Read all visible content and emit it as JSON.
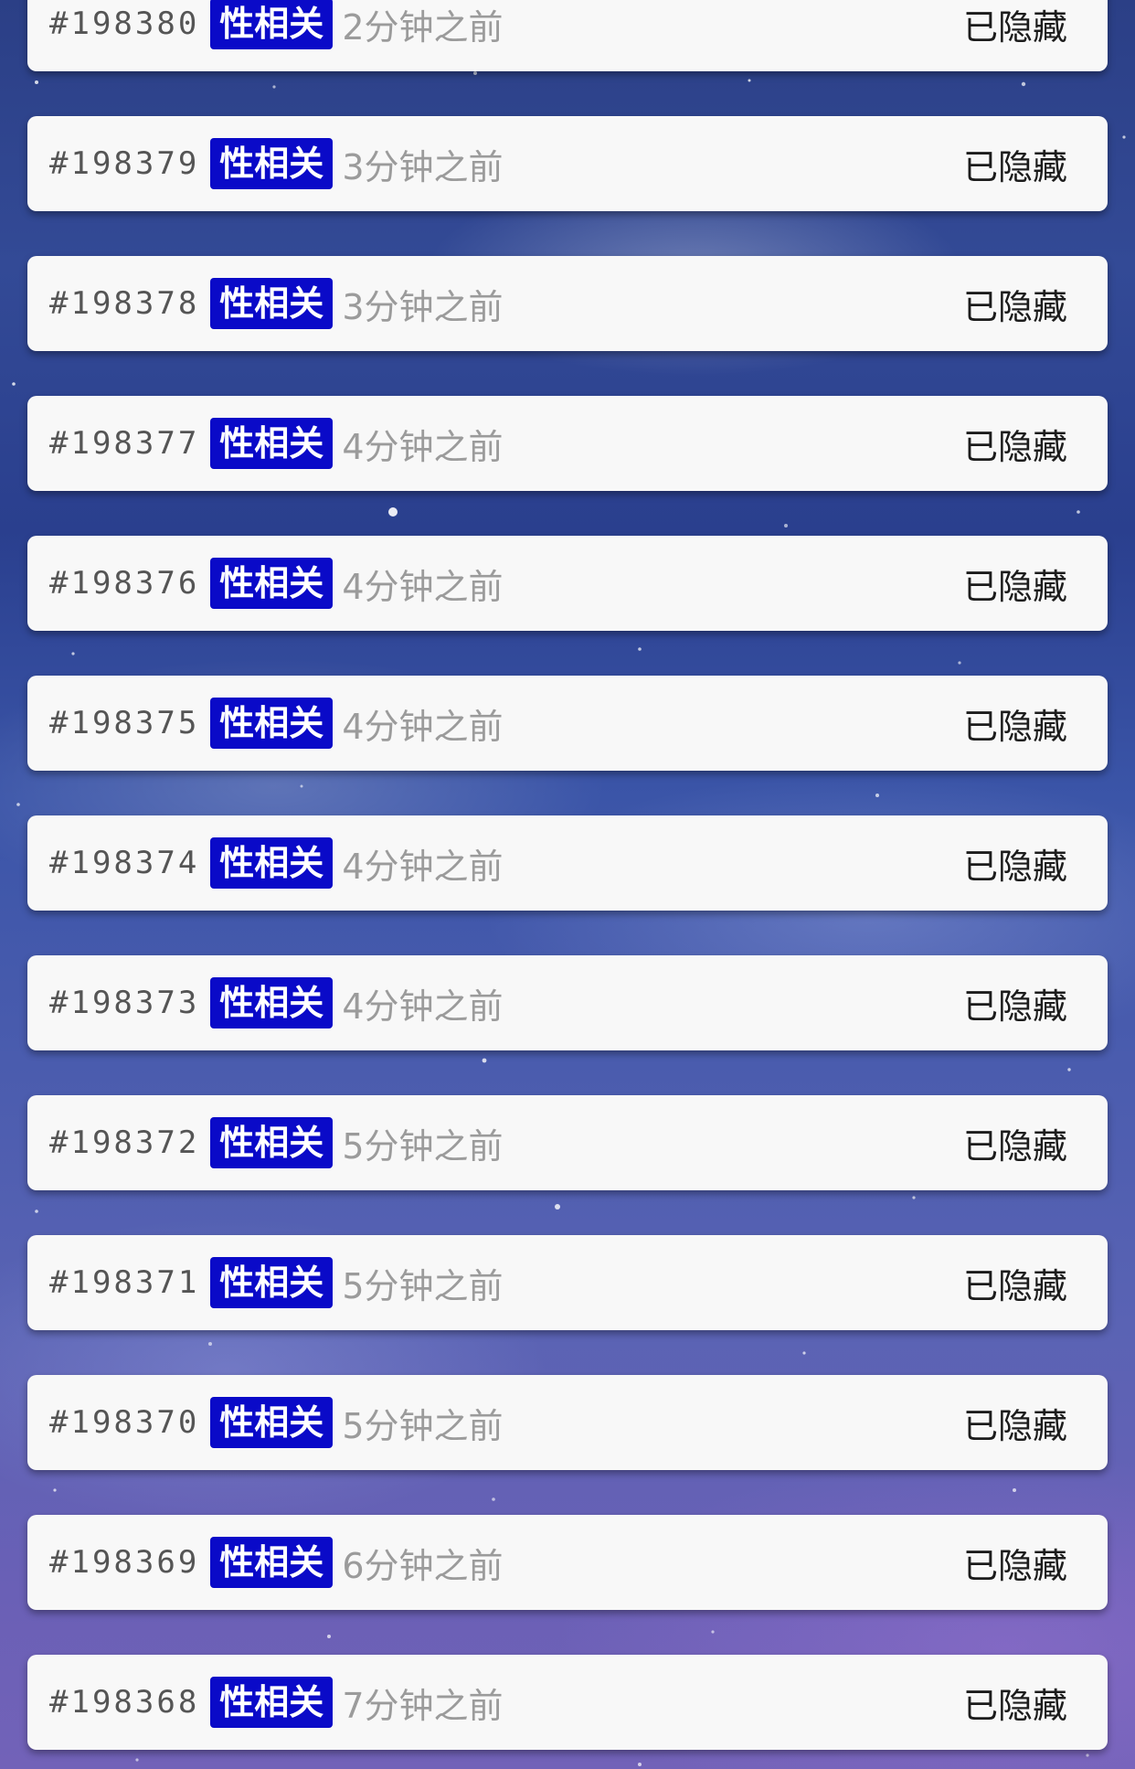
{
  "colors": {
    "tag_background": "#0a0ac8",
    "card_background": "#f8f8f8",
    "time_text": "#9b9b9b",
    "status_text": "#1c1c1c"
  },
  "posts": [
    {
      "id": "#198380",
      "tag": "性相关",
      "time": "2分钟之前",
      "status": "已隐藏"
    },
    {
      "id": "#198379",
      "tag": "性相关",
      "time": "3分钟之前",
      "status": "已隐藏"
    },
    {
      "id": "#198378",
      "tag": "性相关",
      "time": "3分钟之前",
      "status": "已隐藏"
    },
    {
      "id": "#198377",
      "tag": "性相关",
      "time": "4分钟之前",
      "status": "已隐藏"
    },
    {
      "id": "#198376",
      "tag": "性相关",
      "time": "4分钟之前",
      "status": "已隐藏"
    },
    {
      "id": "#198375",
      "tag": "性相关",
      "time": "4分钟之前",
      "status": "已隐藏"
    },
    {
      "id": "#198374",
      "tag": "性相关",
      "time": "4分钟之前",
      "status": "已隐藏"
    },
    {
      "id": "#198373",
      "tag": "性相关",
      "time": "4分钟之前",
      "status": "已隐藏"
    },
    {
      "id": "#198372",
      "tag": "性相关",
      "time": "5分钟之前",
      "status": "已隐藏"
    },
    {
      "id": "#198371",
      "tag": "性相关",
      "time": "5分钟之前",
      "status": "已隐藏"
    },
    {
      "id": "#198370",
      "tag": "性相关",
      "time": "5分钟之前",
      "status": "已隐藏"
    },
    {
      "id": "#198369",
      "tag": "性相关",
      "time": "6分钟之前",
      "status": "已隐藏"
    },
    {
      "id": "#198368",
      "tag": "性相关",
      "time": "7分钟之前",
      "status": "已隐藏"
    }
  ]
}
